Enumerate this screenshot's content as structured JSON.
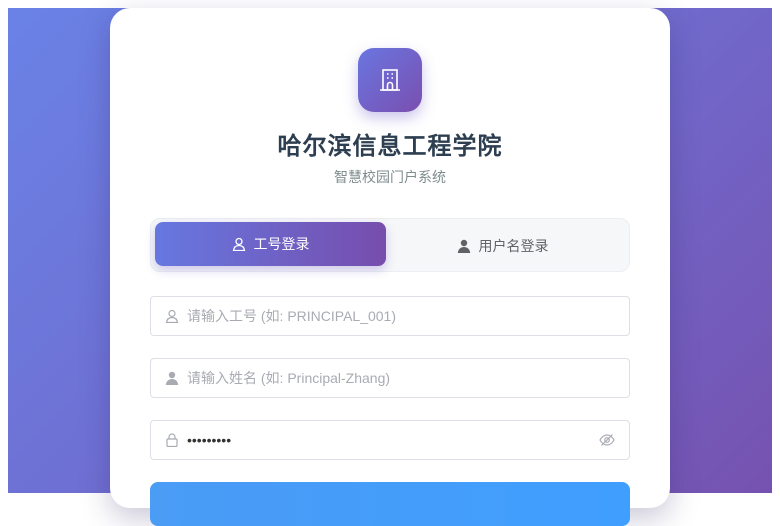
{
  "app": {
    "school_name": "哈尔滨信息工程学院",
    "system_name": "智慧校园门户系统"
  },
  "tabs": [
    {
      "label": "工号登录",
      "active": true,
      "icon": "user-outline-icon"
    },
    {
      "label": "用户名登录",
      "active": false,
      "icon": "user-filled-icon"
    }
  ],
  "form": {
    "employee_id": {
      "placeholder": "请输入工号 (如: PRINCIPAL_001)",
      "value": ""
    },
    "name": {
      "placeholder": "请输入姓名 (如: Principal-Zhang)",
      "value": ""
    },
    "password": {
      "value": "123456789"
    }
  },
  "login_button": {
    "label": ""
  },
  "colors": {
    "brand_start": "#6a82e6",
    "brand_end": "#7652b0",
    "primary_button": "#409eff",
    "title": "#2c3e50"
  }
}
